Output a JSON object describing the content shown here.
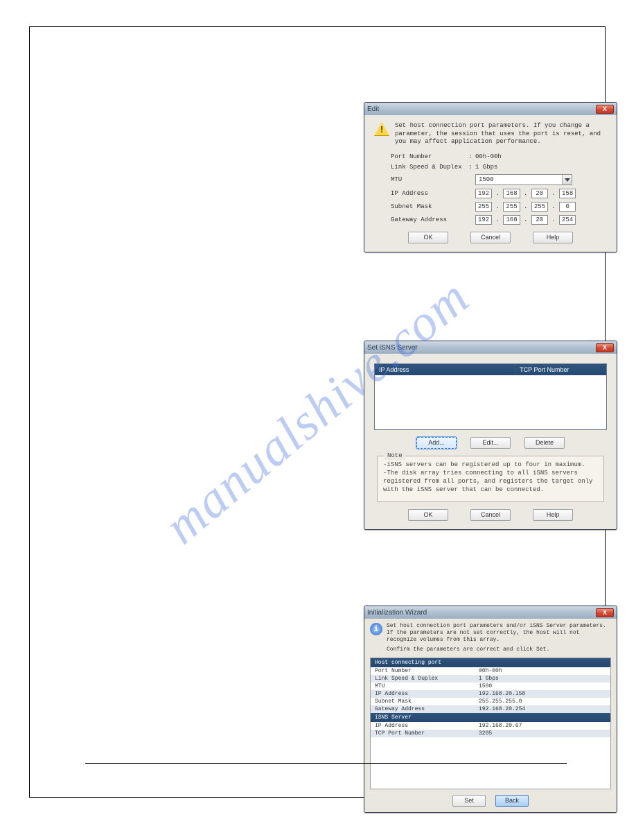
{
  "watermark": "manualshive.com",
  "dlg_edit": {
    "title": "Edit",
    "close": "X",
    "warning": "Set host connection port parameters. If you change a parameter, the session that uses the port is reset, and you may affect application performance.",
    "port_number_label": "Port Number",
    "port_number_value": "00h-00h",
    "link_speed_label": "Link Speed & Duplex",
    "link_speed_value": "1 Gbps",
    "mtu_label": "MTU",
    "mtu_value": "1500",
    "ip_label": "IP Address",
    "ip": [
      "192",
      "168",
      "20",
      "158"
    ],
    "mask_label": "Subnet Mask",
    "mask": [
      "255",
      "255",
      "255",
      "0"
    ],
    "gw_label": "Gateway Address",
    "gw": [
      "192",
      "168",
      "20",
      "254"
    ],
    "ok": "OK",
    "cancel": "Cancel",
    "help": "Help",
    "colon": ":"
  },
  "dlg_isns": {
    "title": "Set iSNS Server",
    "close": "X",
    "col_ip": "IP Address",
    "col_port": "TCP Port Number",
    "add": "Add...",
    "edit": "Edit...",
    "delete": "Delete",
    "note_title": "Note",
    "note_l1": "-iSNS servers can be registered up to four in maximum.",
    "note_l2": "-The disk array tries connecting to all iSNS servers registered from all ports, and registers the target only with the iSNS server that can be connected.",
    "ok": "OK",
    "cancel": "Cancel",
    "help": "Help"
  },
  "dlg_wiz": {
    "title": "Initialization Wizard",
    "close": "X",
    "msg1": "Set host connection port parameters and/or iSNS Server parameters.",
    "msg2": "If the parameters are not set correctly, the host will not recognize volumes from this array.",
    "msg3": "Confirm the parameters are correct and click Set.",
    "section1": "Host connecting port",
    "rows1": [
      {
        "k": "Port Number",
        "v": "00h-00h"
      },
      {
        "k": "Link Speed & Duplex",
        "v": "1 Gbps"
      },
      {
        "k": "MTU",
        "v": "1500"
      },
      {
        "k": "IP Address",
        "v": "192.168.20.158"
      },
      {
        "k": "Subnet Mask",
        "v": "255.255.255.0"
      },
      {
        "k": "Gateway Address",
        "v": "192.168.20.254"
      }
    ],
    "section2": "iSNS Server",
    "rows2": [
      {
        "k": "IP Address",
        "v": "192.168.20.67"
      },
      {
        "k": "TCP Port Number",
        "v": "3205"
      }
    ],
    "set": "Set",
    "back": "Back"
  }
}
